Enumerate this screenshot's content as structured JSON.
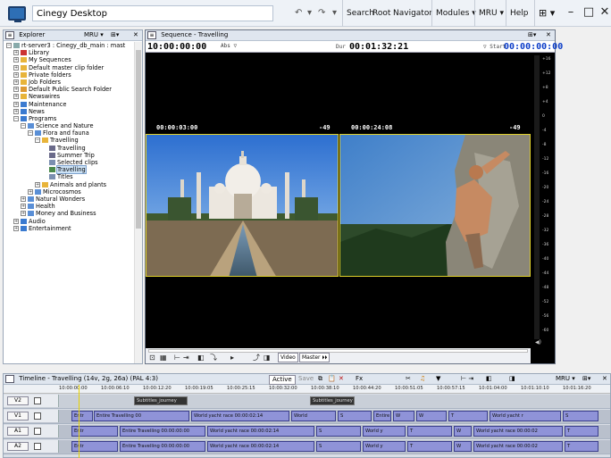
{
  "app": {
    "title": "Cinegy Desktop",
    "toolbar": {
      "search": "Search",
      "root": "Root",
      "navigator": "Navigator",
      "modules": "Modules",
      "mru": "MRU",
      "help": "Help"
    }
  },
  "explorer": {
    "title": "Explorer",
    "mru": "MRU",
    "tree": [
      {
        "label": "rt-server3 : Cinegy_db_main : mast",
        "depth": 0,
        "expanded": true,
        "icon": "server"
      },
      {
        "label": "Library",
        "depth": 1,
        "icon": "library"
      },
      {
        "label": "My Sequences",
        "depth": 1,
        "icon": "folder"
      },
      {
        "label": "Default master clip folder",
        "depth": 1,
        "icon": "folder"
      },
      {
        "label": "Private folders",
        "depth": 1,
        "icon": "folder"
      },
      {
        "label": "Job Folders",
        "depth": 1,
        "icon": "folder"
      },
      {
        "label": "Default Public Search Folder",
        "depth": 1,
        "icon": "search-folder"
      },
      {
        "label": "Newswires",
        "depth": 1,
        "icon": "folder"
      },
      {
        "label": "Maintenance",
        "depth": 1,
        "icon": "tools"
      },
      {
        "label": "News",
        "depth": 1,
        "icon": "tools"
      },
      {
        "label": "Programs",
        "depth": 1,
        "expanded": true,
        "icon": "tools"
      },
      {
        "label": "Science and Nature",
        "depth": 2,
        "expanded": true,
        "icon": "bin"
      },
      {
        "label": "Flora and fauna",
        "depth": 3,
        "expanded": true,
        "icon": "bin"
      },
      {
        "label": "Travelling",
        "depth": 4,
        "expanded": true,
        "icon": "folder"
      },
      {
        "label": "Travelling",
        "depth": 5,
        "icon": "roll"
      },
      {
        "label": "Summer Trip",
        "depth": 5,
        "icon": "roll"
      },
      {
        "label": "Selected clips",
        "depth": 5,
        "icon": "clipbin"
      },
      {
        "label": "Travelling",
        "depth": 5,
        "icon": "sequence",
        "selected": true
      },
      {
        "label": "Titles",
        "depth": 5,
        "icon": "clipbin"
      },
      {
        "label": "Animals and plants",
        "depth": 4,
        "icon": "folder"
      },
      {
        "label": "Microcosmos",
        "depth": 3,
        "icon": "bin"
      },
      {
        "label": "Natural Wonders",
        "depth": 2,
        "icon": "bin"
      },
      {
        "label": "Health",
        "depth": 2,
        "icon": "bin"
      },
      {
        "label": "Money and Business",
        "depth": 2,
        "icon": "bin"
      },
      {
        "label": "Audio",
        "depth": 1,
        "icon": "tools"
      },
      {
        "label": "Entertainment",
        "depth": 1,
        "icon": "tools"
      }
    ]
  },
  "sequence": {
    "title": "Sequence - Travelling",
    "timecode": "10:00:00:00",
    "abs": "Abs",
    "dur_label": "Dur",
    "duration": "00:01:32:21",
    "start_label": "Start",
    "start": "00:00:00:00",
    "left_tc": "00:00:03:00",
    "left_db": "-49",
    "right_tc": "00:00:24:08",
    "right_db": "-49",
    "video_btn": "Video",
    "master_btn": "Master",
    "meter_marks": [
      "+16",
      "+12",
      "+8",
      "+4",
      "0",
      "-4",
      "-8",
      "-12",
      "-16",
      "-20",
      "-24",
      "-28",
      "-32",
      "-36",
      "-40",
      "-44",
      "-48",
      "-52",
      "-56",
      "-60"
    ]
  },
  "timeline": {
    "title": "Timeline - Travelling (14v, 2g, 26a) (PAL 4:3)",
    "active": "Active",
    "save": "Save",
    "mru": "MRU",
    "ruler": [
      "10:00:00:00",
      "10:00:06:10",
      "10:00:12:20",
      "10:00:19:05",
      "10:00:25:15",
      "10:00:32:00",
      "10:00:38:10",
      "10:00:44:20",
      "10:00:51:05",
      "10:00:57:15",
      "10:01:04:00",
      "10:01:10:10",
      "10:01:16:20"
    ],
    "tracks": [
      "V2",
      "V1",
      "A1",
      "A2"
    ],
    "v2_clips": [
      "Subtitles_journey",
      "Subtitles_journey"
    ],
    "v1_clips": [
      "Entr",
      "Entire Travelling 00",
      "World yacht race 00:00:02:14",
      "World",
      "S",
      "Entire",
      "W",
      "W",
      "T",
      "World yacht r",
      "S"
    ],
    "a1_clips": [
      "Entr",
      "Entire Travelling 00:00:00:00",
      "World yacht race 00:00:02:14",
      "S",
      "World y",
      "T",
      "W",
      "World yacht race 00:00:02",
      "T"
    ],
    "a2_clips": [
      "Entr",
      "Entire Travelling 00:00:00:00",
      "World yacht race 00:00:02:14",
      "S",
      "World y",
      "T",
      "W",
      "World yacht race 00:00:02",
      "T"
    ]
  }
}
